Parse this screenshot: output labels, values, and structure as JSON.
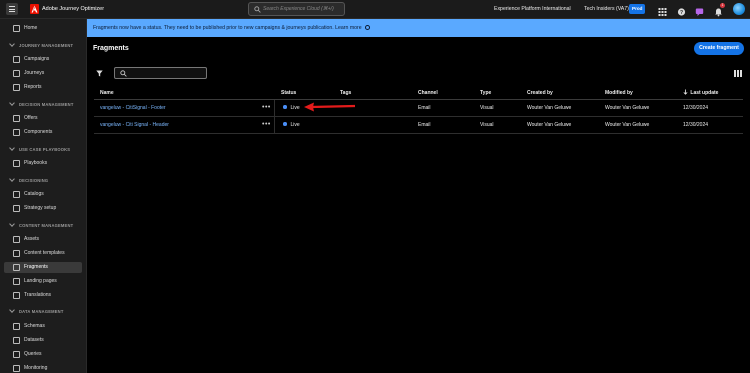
{
  "app": {
    "title": "Adobe Journey Optimizer",
    "search_placeholder": "Search Experience Cloud (⌘+/)",
    "org_name": "Experience Platform International",
    "sandbox_name": "Tech Insiders (VA7)",
    "env_badge": "Prod",
    "notification_count": "1"
  },
  "sidebar": {
    "home": "Home",
    "sections": {
      "journey_management": "JOURNEY MANAGEMENT",
      "decision_management": "DECISION MANAGEMENT",
      "use_case_playbooks": "USE CASE PLAYBOOKS",
      "decisioning": "DECISIONING",
      "content_management": "CONTENT MANAGEMENT",
      "data_management": "DATA MANAGEMENT"
    },
    "items": {
      "campaigns": "Campaigns",
      "journeys": "Journeys",
      "reports": "Reports",
      "offers": "Offers",
      "components": "Components",
      "playbooks": "Playbooks",
      "catalogs": "Catalogs",
      "strategy_setup": "Strategy setup",
      "assets": "Assets",
      "content_templates": "Content templates",
      "fragments": "Fragments",
      "landing_pages": "Landing pages",
      "translations": "Translations",
      "schemas": "Schemas",
      "datasets": "Datasets",
      "queries": "Queries",
      "monitoring": "Monitoring"
    }
  },
  "banner": {
    "text": "Fragments now have a status. They need to be published prior to new campaigns & journeys publication. Learn more"
  },
  "page": {
    "title": "Fragments",
    "create_button": "Create fragment",
    "search_value": ""
  },
  "table": {
    "headers": {
      "name": "Name",
      "status": "Status",
      "tags": "Tags",
      "channel": "Channel",
      "type": "Type",
      "created_by": "Created by",
      "modified_by": "Modified by",
      "last_update": "Last update"
    },
    "rows": [
      {
        "name": "vangeluw - CitiSignal - Footer",
        "status": "Live",
        "tags": "",
        "channel": "Email",
        "type": "Visual",
        "created_by": "Wouter Van Geluwe",
        "modified_by": "Wouter Van Geluwe",
        "last_update": "12/30/2024"
      },
      {
        "name": "vangeluw - Citi Signal - Header",
        "status": "Live",
        "tags": "",
        "channel": "Email",
        "type": "Visual",
        "created_by": "Wouter Van Geluwe",
        "modified_by": "Wouter Van Geluwe",
        "last_update": "12/30/2024"
      }
    ],
    "row_actions": "•••"
  },
  "colors": {
    "accent": "#1473e6",
    "banner": "#5aa9ff",
    "link": "#7cb8ff",
    "arrow": "#e31b1b",
    "status_live": "#4a8ef7"
  }
}
